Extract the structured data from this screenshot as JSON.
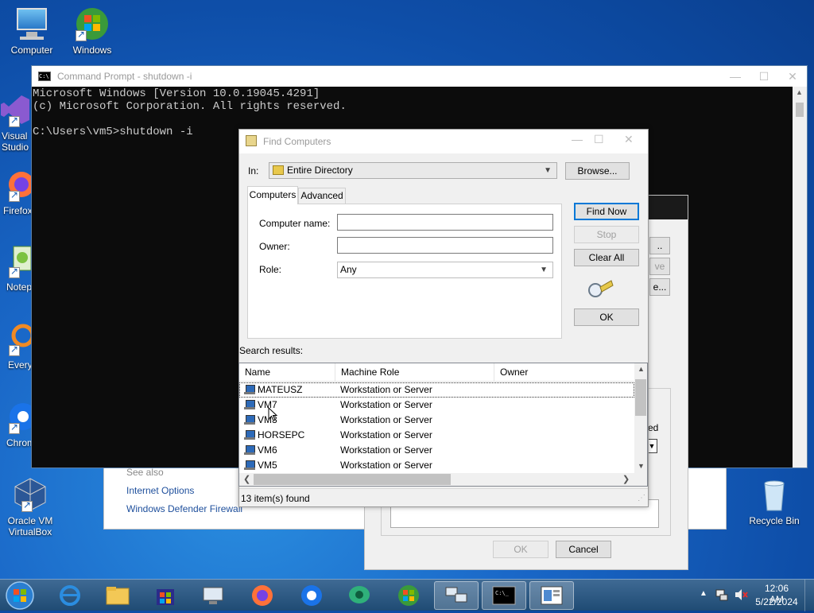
{
  "desktop": {
    "icons": [
      {
        "label": "Computer"
      },
      {
        "label": "Windows Media Center"
      },
      {
        "label": "Visual Studio 2019"
      },
      {
        "label": "Firefox"
      },
      {
        "label": "Notepad++"
      },
      {
        "label": "Everything"
      },
      {
        "label": "Chrome"
      },
      {
        "label": "Oracle VM VirtualBox"
      },
      {
        "label": "Recycle Bin"
      }
    ]
  },
  "cmd": {
    "title": "Command Prompt - shutdown -i",
    "lines": [
      "Microsoft Windows [Version 10.0.19045.4291]",
      "(c) Microsoft Corporation. All rights reserved.",
      "",
      "C:\\Users\\vm5>shutdown -i"
    ]
  },
  "control_panel": {
    "see_also": "See also",
    "links": [
      "Internet Options",
      "Windows Defender Firewall"
    ]
  },
  "shutdown_dialog": {
    "ok_label": "OK",
    "cancel_label": "Cancel",
    "fragment_label": "ed"
  },
  "find_dialog": {
    "title": "Find Computers",
    "in_label": "In:",
    "in_value": "Entire Directory",
    "browse_label": "Browse...",
    "tabs": [
      {
        "label": "Computers"
      },
      {
        "label": "Advanced"
      }
    ],
    "computer_name_label": "Computer name:",
    "computer_name_value": "",
    "owner_label": "Owner:",
    "owner_value": "",
    "role_label": "Role:",
    "role_value": "Any",
    "find_now_label": "Find Now",
    "stop_label": "Stop",
    "clear_all_label": "Clear All",
    "ok_label": "OK",
    "search_results_label": "Search results:",
    "columns": [
      "Name",
      "Machine Role",
      "Owner"
    ],
    "rows": [
      {
        "name": "MATEUSZ",
        "role": "Workstation or Server",
        "owner": ""
      },
      {
        "name": "VM7",
        "role": "Workstation or Server",
        "owner": ""
      },
      {
        "name": "VM3",
        "role": "Workstation or Server",
        "owner": ""
      },
      {
        "name": "HORSEPC",
        "role": "Workstation or Server",
        "owner": ""
      },
      {
        "name": "VM6",
        "role": "Workstation or Server",
        "owner": ""
      },
      {
        "name": "VM5",
        "role": "Workstation or Server",
        "owner": ""
      }
    ],
    "status": "13 item(s) found"
  },
  "taskbar": {
    "time": "12:06 AM",
    "date": "5/22/2024"
  },
  "colors": {
    "desktop": "#1a68c8",
    "accent": "#0078d7",
    "taskbar": "#2a5680"
  }
}
